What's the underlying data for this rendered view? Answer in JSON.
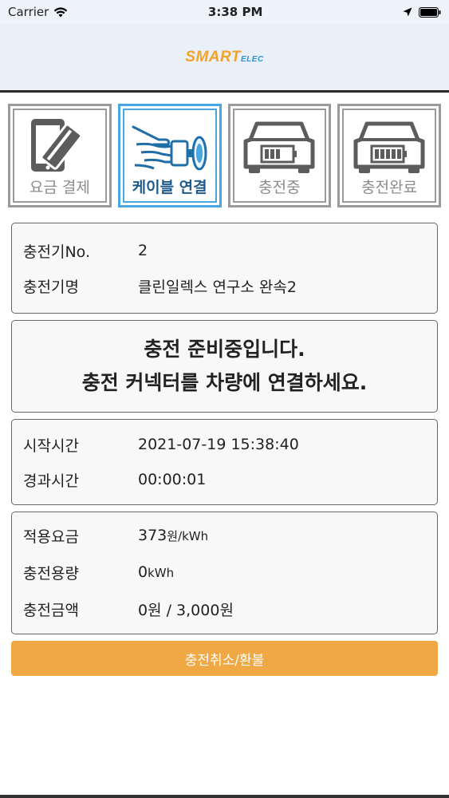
{
  "status_bar": {
    "carrier": "Carrier",
    "time": "3:38 PM"
  },
  "header": {
    "logo_main": "SMART",
    "logo_sub": "ELEC"
  },
  "steps": [
    {
      "label": "요금 결제",
      "active": false,
      "icon": "payment-card-icon"
    },
    {
      "label": "케이블 연결",
      "active": true,
      "icon": "cable-plug-icon"
    },
    {
      "label": "충전중",
      "active": false,
      "icon": "car-battery-charging-icon"
    },
    {
      "label": "충전완료",
      "active": false,
      "icon": "car-battery-full-icon"
    }
  ],
  "charger_info": {
    "no_label": "충전기No.",
    "no_value": "2",
    "name_label": "충전기명",
    "name_value": "클린일렉스 연구소 완속2"
  },
  "message": {
    "line1": "충전 준비중입니다.",
    "line2": "충전 커넥터를 차량에 연결하세요."
  },
  "time_info": {
    "start_label": "시작시간",
    "start_value": "2021-07-19 15:38:40",
    "elapsed_label": "경과시간",
    "elapsed_value": "00:00:01"
  },
  "fee_info": {
    "rate_label": "적용요금",
    "rate_value": "373",
    "rate_unit": "원/kWh",
    "capacity_label": "충전용량",
    "capacity_value": "0",
    "capacity_unit": "kWh",
    "amount_label": "충전금액",
    "amount_value": "0원 / 3,000원"
  },
  "cancel_button": "충전취소/환불",
  "colors": {
    "accent": "#f0a845",
    "active_step": "#4aa6e0",
    "logo_orange": "#f3a32a",
    "logo_blue": "#2d8fd6"
  }
}
